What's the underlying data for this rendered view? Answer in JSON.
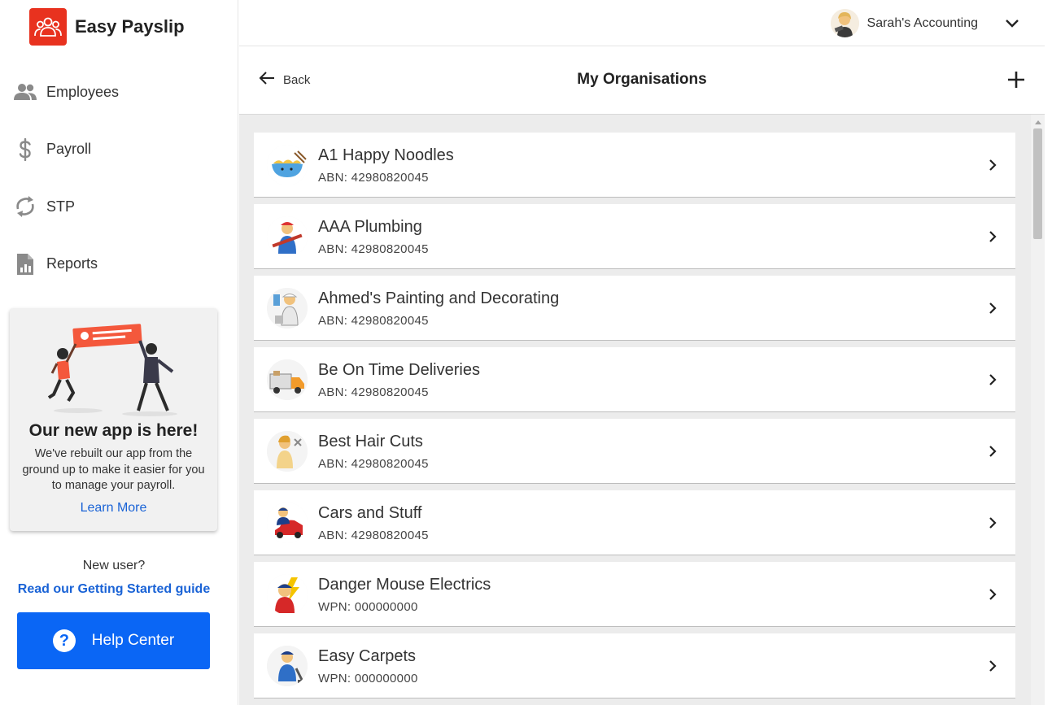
{
  "brand": {
    "name": "Easy Payslip",
    "color": "#e8321f"
  },
  "nav": [
    {
      "label": "Employees",
      "icon": "people-icon"
    },
    {
      "label": "Payroll",
      "icon": "dollar-icon"
    },
    {
      "label": "STP",
      "icon": "sync-icon"
    },
    {
      "label": "Reports",
      "icon": "report-icon"
    }
  ],
  "promo": {
    "title": "Our new app is here!",
    "text": "We've rebuilt our app from the ground up to make it easier for you to manage your payroll.",
    "link": "Learn More"
  },
  "sidebar_footer": {
    "new_user": "New user?",
    "guide_link": "Read our Getting Started guide",
    "help_label": "Help Center"
  },
  "user": {
    "name": "Sarah's Accounting"
  },
  "page": {
    "back_label": "Back",
    "title": "My Organisations"
  },
  "organisations": [
    {
      "name": "A1 Happy Noodles",
      "id": "ABN: 42980820045",
      "icon": "noodle-bowl-icon"
    },
    {
      "name": "AAA Plumbing",
      "id": "ABN: 42980820045",
      "icon": "plumber-icon"
    },
    {
      "name": "Ahmed's Painting and Decorating",
      "id": "ABN: 42980820045",
      "icon": "painter-icon"
    },
    {
      "name": "Be On Time Deliveries",
      "id": "ABN: 42980820045",
      "icon": "delivery-truck-icon"
    },
    {
      "name": "Best Hair Cuts",
      "id": "ABN: 42980820045",
      "icon": "hairdresser-icon"
    },
    {
      "name": "Cars and Stuff",
      "id": "ABN: 42980820045",
      "icon": "mechanic-icon"
    },
    {
      "name": "Danger Mouse Electrics",
      "id": "WPN: 000000000",
      "icon": "electrician-icon"
    },
    {
      "name": "Easy Carpets",
      "id": "WPN: 000000000",
      "icon": "carpet-cleaner-icon"
    }
  ],
  "colors": {
    "accent": "#0a66f5",
    "link": "#1a63d6",
    "list_bg": "#ececec"
  }
}
